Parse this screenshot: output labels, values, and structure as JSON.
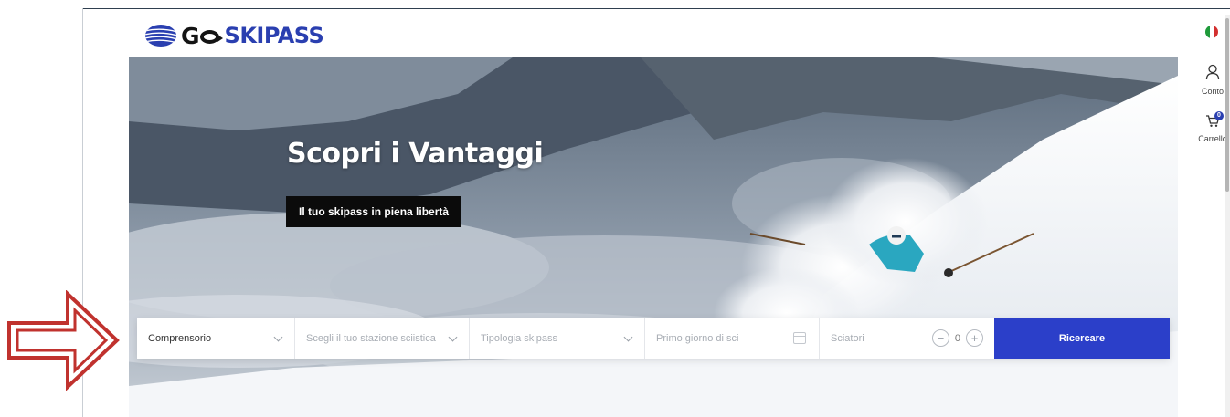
{
  "brand": {
    "logo_go": "G",
    "logo_skipass": "SKIPASS"
  },
  "sidebar": {
    "account_label": "Conto",
    "cart_label": "Carrello",
    "cart_count": "0"
  },
  "hero": {
    "title": "Scopri i Vantaggi",
    "badge": "Il tuo skipass in piena libertà"
  },
  "search": {
    "area_value": "Comprensorio",
    "station_placeholder": "Scegli il tuo stazione sciistica",
    "type_placeholder": "Tipologia skipass",
    "date_placeholder": "Primo giorno di sci",
    "skiers_label": "Sciatori",
    "skiers_count": "0",
    "minus": "−",
    "plus": "+",
    "submit_label": "Ricercare"
  },
  "colors": {
    "brand_blue": "#2a3fb0",
    "button_blue": "#2b3fc9",
    "annotation_red": "#c0322e"
  },
  "icons": [
    "globe-logo-icon",
    "italy-flag-icon",
    "user-icon",
    "cart-icon",
    "chevron-down-icon",
    "calendar-icon",
    "minus-icon",
    "plus-icon",
    "red-arrow-icon"
  ]
}
